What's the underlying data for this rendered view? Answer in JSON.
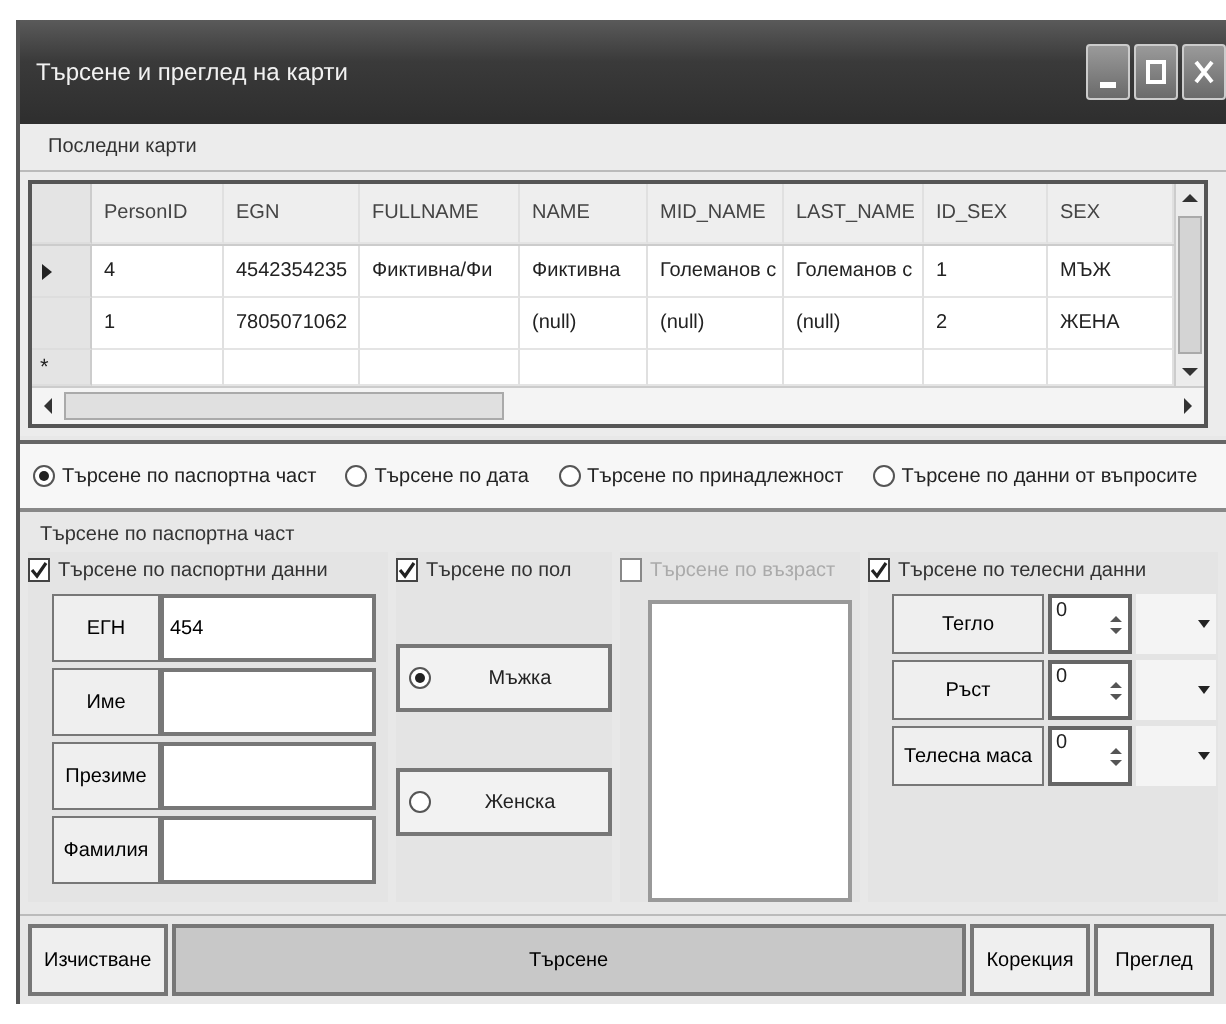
{
  "window": {
    "title": "Търсене и преглед на карти"
  },
  "menu": [
    "Последни карти"
  ],
  "grid": {
    "columns": [
      "PersonID",
      "EGN",
      "FULLNAME",
      "NAME",
      "MID_NAME",
      "LAST_NAME",
      "ID_SEX",
      "SEX"
    ],
    "rows": [
      {
        "selected": true,
        "cells": [
          "4",
          "4542354235",
          "Фиктивна/Фи",
          "Фиктивна",
          "Големанов с",
          "Големанов с",
          "1",
          "МЪЖ"
        ]
      },
      {
        "selected": false,
        "cells": [
          "1",
          "7805071062",
          null,
          "(null)",
          "(null)",
          "(null)",
          "2",
          "ЖЕНА"
        ]
      }
    ],
    "new_row_mark": "*"
  },
  "search_modes": [
    {
      "label": "Търсене по паспортна част",
      "selected": true
    },
    {
      "label": "Търсене по дата",
      "selected": false
    },
    {
      "label": "Търсене по принадлежност",
      "selected": false
    },
    {
      "label": "Търсене по данни от въпросите",
      "selected": false
    }
  ],
  "panel": {
    "title": "Търсене по паспортна част",
    "passport": {
      "title": "Търсене по паспортни данни",
      "checked": true,
      "fields": [
        {
          "label": "ЕГН",
          "value": "454"
        },
        {
          "label": "Име"
        },
        {
          "label": "Презиме"
        },
        {
          "label": "Фамилия"
        }
      ]
    },
    "sex": {
      "title": "Търсене по пол",
      "checked": true,
      "options": [
        {
          "label": "Мъжка",
          "selected": true
        },
        {
          "label": "Женска",
          "selected": false
        }
      ]
    },
    "age": {
      "title": "Търсене по възраст",
      "checked": false,
      "disabled": true
    },
    "body": {
      "title": "Търсене по телесни данни",
      "checked": true,
      "fields": [
        {
          "label": "Тегло",
          "value": "0"
        },
        {
          "label": "Ръст",
          "value": "0"
        },
        {
          "label": "Телесна маса",
          "value": "0"
        }
      ]
    }
  },
  "buttons": [
    {
      "label": "Изчистване",
      "kind": "normal"
    },
    {
      "label": "Търсене",
      "kind": "wide"
    },
    {
      "label": "Корекция",
      "kind": "normal"
    },
    {
      "label": "Преглед",
      "kind": "normal"
    }
  ]
}
